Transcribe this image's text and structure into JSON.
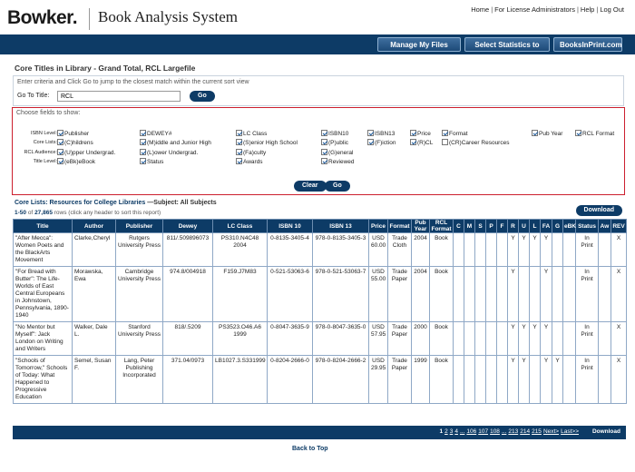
{
  "header": {
    "logo": "Bowker.",
    "app_title": "Book Analysis System",
    "links": [
      "Home",
      "For License Administrators",
      "Help",
      "Log Out"
    ]
  },
  "nav": {
    "buttons": [
      "Manage My Files",
      "Select Statistics to View",
      "BooksInPrint.com"
    ]
  },
  "page_title": "Core Titles in Library - Grand Total, RCL Largefile",
  "goto": {
    "instruction": "Enter criteria and Click Go to jump to the closest match within the current sort view",
    "label": "Go To Title:",
    "value": "RCL",
    "button": "Go"
  },
  "fields": {
    "caption": "Choose fields to show:",
    "levels": [
      "ISBN Level:",
      "Core Lists:",
      "RCL Audience:",
      "Title Level:"
    ],
    "checkboxes": [
      {
        "label": "Publisher",
        "checked": true
      },
      {
        "label": "DEWEY#",
        "checked": true
      },
      {
        "label": "LC Class",
        "checked": true
      },
      {
        "label": "ISBN10",
        "checked": true
      },
      {
        "label": "ISBN13",
        "checked": true
      },
      {
        "label": "Price",
        "checked": true
      },
      {
        "label": "Format",
        "checked": true
      },
      {
        "label": "Pub Year",
        "checked": true
      },
      {
        "label": "RCL Format",
        "checked": true
      },
      {
        "label": "(C)hildrens",
        "checked": true
      },
      {
        "label": "(M)iddle and Junior High",
        "checked": true
      },
      {
        "label": "(S)enior High School",
        "checked": true
      },
      {
        "label": "(P)ublic",
        "checked": true
      },
      {
        "label": "(F)iction",
        "checked": true
      },
      {
        "label": "(R)CL",
        "checked": true
      },
      {
        "label": "(CR)Career Resources",
        "checked": false
      },
      {
        "label": "(U)pper Undergrad.",
        "checked": true
      },
      {
        "label": "(L)ower Undergrad.",
        "checked": true
      },
      {
        "label": "(Fa)culty",
        "checked": true
      },
      {
        "label": "(G)eneral",
        "checked": true
      },
      {
        "label": "(eBk)eBook",
        "checked": true
      },
      {
        "label": "Status",
        "checked": true
      },
      {
        "label": "Awards",
        "checked": true
      },
      {
        "label": "Reviewed",
        "checked": true
      }
    ],
    "clear_button": "Clear",
    "go_button": "Go"
  },
  "list": {
    "title": "Core Lists: Resources for College Libraries",
    "subtitle": " —Subject: All Subjects",
    "range": "1-50",
    "of": " of ",
    "total": "27,865",
    "rows_text": " rows (click any header to sort this report)",
    "download": "Download"
  },
  "table": {
    "columns": [
      "Title",
      "Author",
      "Publisher",
      "Dewey",
      "LC Class",
      "ISBN 10",
      "ISBN 13",
      "Price",
      "Format",
      "Pub Year",
      "RCL Format",
      "C",
      "M",
      "S",
      "P",
      "F",
      "R",
      "U",
      "L",
      "FA",
      "G",
      "eBK",
      "Status",
      "Aw",
      "REV"
    ],
    "rows": [
      [
        "\"After Mecca\": Women Poets and the BlackArts Movement",
        "Clarke,Cheryl",
        "Rutgers University Press",
        "811/.509896073",
        "PS310.N4C48 2004",
        "0-8135-3405-4",
        "978-0-8135-3405-3",
        "USD 60.00",
        "Trade Cloth",
        "2004",
        "Book",
        "",
        "",
        "",
        "",
        "",
        "Y",
        "Y",
        "Y",
        "Y",
        "",
        "",
        "In Print",
        "",
        "X"
      ],
      [
        "\"For Bread with Butter\": The Life-Worlds of East Central Europeans in Johnstown, Pennsylvania, 1890-1940",
        "Morawska, Ewa",
        "Cambridge University Press",
        "974.8/004918",
        "F159.J7M83",
        "0-521-53063-6",
        "978-0-521-53063-7",
        "USD 55.00",
        "Trade Paper",
        "2004",
        "Book",
        "",
        "",
        "",
        "",
        "",
        "Y",
        "",
        "",
        "Y",
        "",
        "",
        "In Print",
        "",
        "X"
      ],
      [
        "\"No Mentor but Myself\": Jack London on Writing and Writers",
        "Walker, Dale L.",
        "Stanford University Press",
        "818/.5209",
        "PS3523.O46.A6 1999",
        "0-8047-3635-9",
        "978-0-8047-3635-0",
        "USD 57.95",
        "Trade Paper",
        "2000",
        "Book",
        "",
        "",
        "",
        "",
        "",
        "Y",
        "Y",
        "Y",
        "Y",
        "",
        "",
        "In Print",
        "",
        "X"
      ],
      [
        "\"Schools of Tomorrow,\" Schools of Today: What Happened to Progressive Education",
        "Semel, Susan F.",
        "Lang, Peter Publishing Incorporated",
        "371.04/0973",
        "LB1027.3.S331999",
        "0-8204-2666-0",
        "978-0-8204-2666-2",
        "USD 29.95",
        "Trade Paper",
        "1999",
        "Book",
        "",
        "",
        "",
        "",
        "",
        "Y",
        "Y",
        "",
        "Y",
        "Y",
        "",
        "In Print",
        "",
        "X"
      ]
    ]
  },
  "pager": {
    "pages": [
      "1",
      "2",
      "3",
      "4",
      "...",
      "106",
      "107",
      "108",
      "...",
      "213",
      "214",
      "215",
      "Next>",
      "Last>>"
    ],
    "download": "Download"
  },
  "footer": {
    "back_to_top": "Back to Top"
  }
}
